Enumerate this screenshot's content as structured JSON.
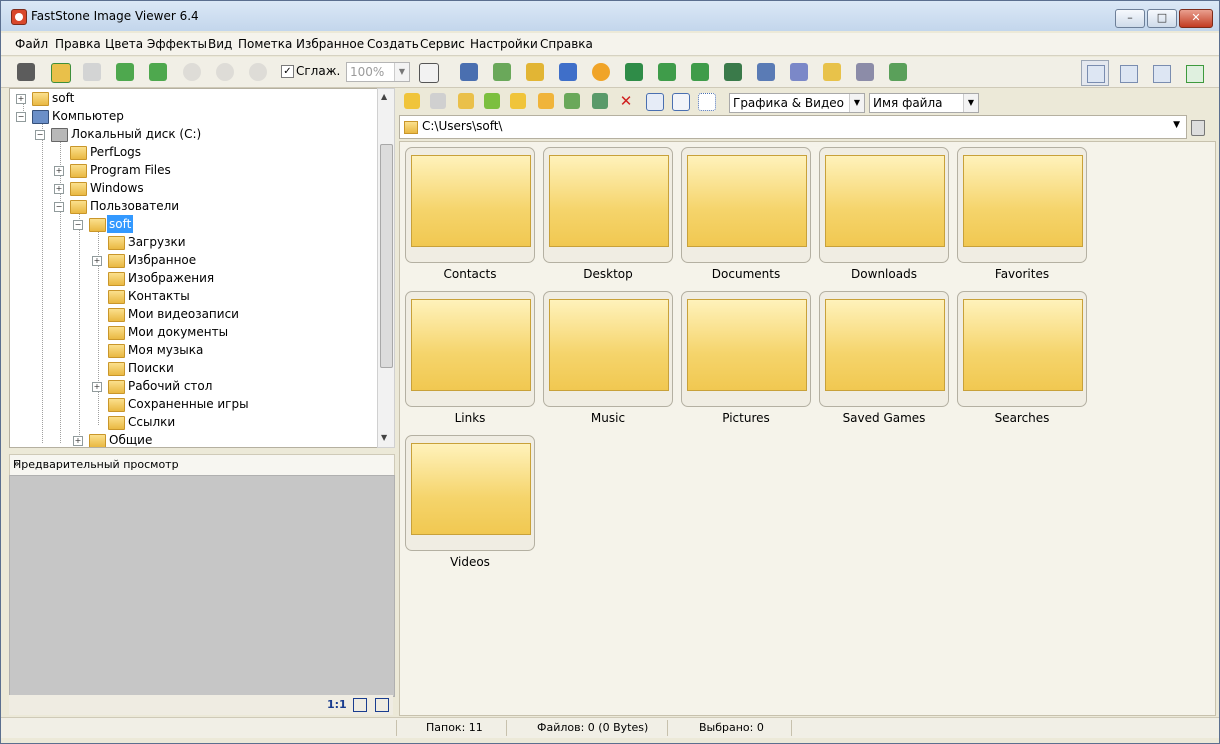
{
  "window": {
    "title": "FastStone Image Viewer 6.4"
  },
  "menu": [
    "Файл",
    "Правка",
    "Цвета",
    "Эффекты",
    "Вид",
    "Пометка",
    "Избранное",
    "Создать",
    "Сервис",
    "Настройки",
    "Справка"
  ],
  "toolbar": {
    "smooth_label": "Сглаж.",
    "smooth_checked": "✓",
    "zoom_value": "100%"
  },
  "tree": {
    "items": [
      {
        "label": "soft"
      },
      {
        "label": "Компьютер"
      },
      {
        "label": "Локальный диск (C:)"
      },
      {
        "label": "PerfLogs"
      },
      {
        "label": "Program Files"
      },
      {
        "label": "Windows"
      },
      {
        "label": "Пользователи"
      },
      {
        "label": "soft"
      },
      {
        "label": "Загрузки"
      },
      {
        "label": "Избранное"
      },
      {
        "label": "Изображения"
      },
      {
        "label": "Контакты"
      },
      {
        "label": "Мои видеозаписи"
      },
      {
        "label": "Мои документы"
      },
      {
        "label": "Моя музыка"
      },
      {
        "label": "Поиски"
      },
      {
        "label": "Рабочий стол"
      },
      {
        "label": "Сохраненные игры"
      },
      {
        "label": "Ссылки"
      },
      {
        "label": "Общие"
      }
    ]
  },
  "preview": {
    "header": "Предварительный просмотр",
    "ratio_label": "1:1"
  },
  "browser": {
    "filter_value": "Графика & Видео",
    "sort_value": "Имя файла",
    "path": "C:\\Users\\soft\\",
    "folders": [
      {
        "name": "Contacts"
      },
      {
        "name": "Desktop"
      },
      {
        "name": "Documents"
      },
      {
        "name": "Downloads"
      },
      {
        "name": "Favorites"
      },
      {
        "name": "Links"
      },
      {
        "name": "Music"
      },
      {
        "name": "Pictures"
      },
      {
        "name": "Saved Games"
      },
      {
        "name": "Searches"
      },
      {
        "name": "Videos"
      }
    ]
  },
  "status": {
    "folders": "Папок: 11",
    "files": "Файлов: 0 (0 Bytes)",
    "selected": "Выбрано: 0"
  },
  "colors": {
    "selection": "#3399ff",
    "folder_fill": "#f5d46b"
  }
}
